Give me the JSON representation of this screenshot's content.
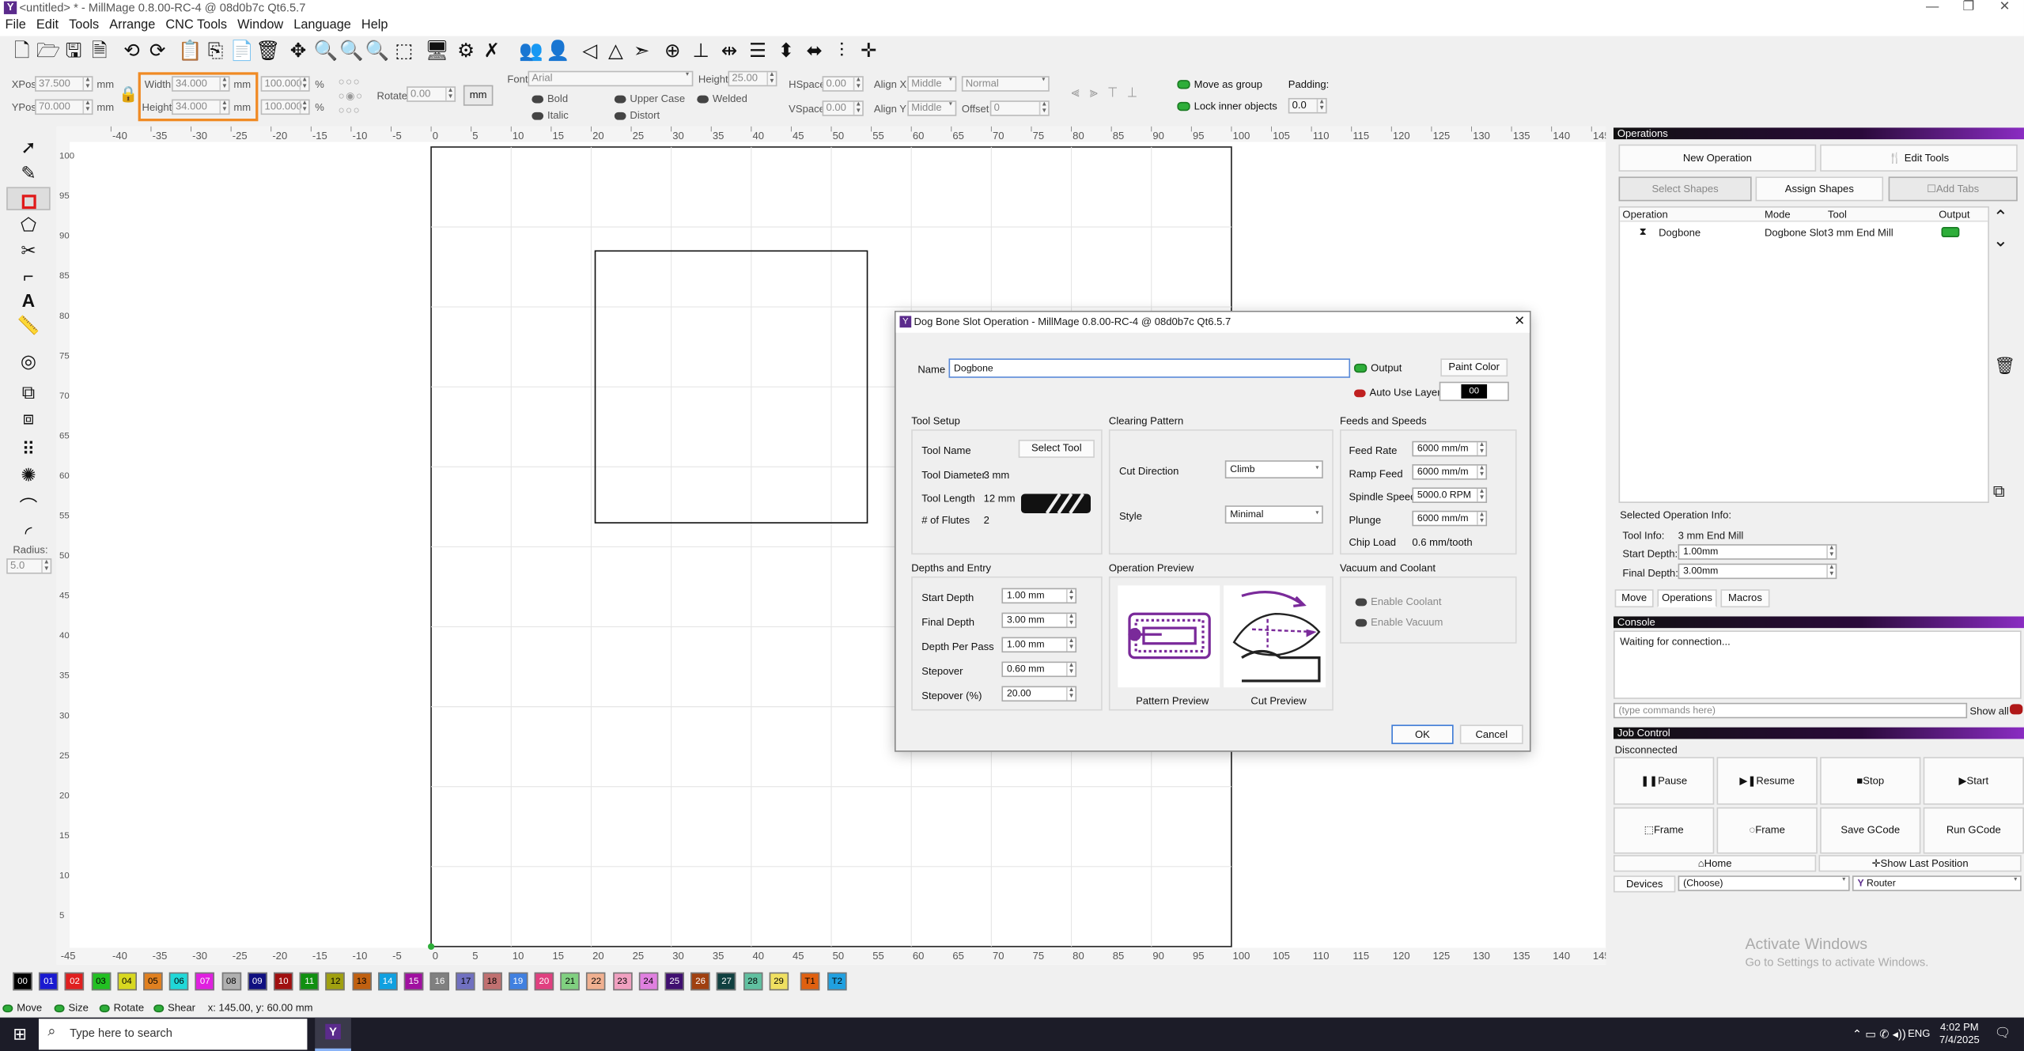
{
  "titlebar": {
    "title": "<untitled> * - MillMage 0.8.00-RC-4 @ 08d0b7c Qt6.5.7",
    "minimize": "—",
    "restore": "❐",
    "close": "✕"
  },
  "menu": [
    "File",
    "Edit",
    "Tools",
    "Arrange",
    "CNC Tools",
    "Window",
    "Language",
    "Help"
  ],
  "props": {
    "xpos_label": "XPos",
    "xpos": "37.500",
    "ypos_label": "YPos",
    "ypos": "70.000",
    "mm": "mm",
    "width_label": "Width",
    "width": "34.000",
    "height_label": "Height",
    "height": "34.000",
    "wpct": "100.000",
    "hpct": "100.000",
    "pct": "%",
    "rotate_label": "Rotate",
    "rotate": "0.00",
    "unit_button": "mm",
    "font_label": "Font",
    "font": "Arial",
    "fheight_label": "Height",
    "fheight": "25.00",
    "bold": "Bold",
    "italic": "Italic",
    "upper": "Upper Case",
    "distort": "Distort",
    "welded": "Welded",
    "hspace_label": "HSpace",
    "hspace": "0.00",
    "vspace_label": "VSpace",
    "vspace": "0.00",
    "alignx_label": "Align X",
    "alignx": "Middle",
    "aligny_label": "Align Y",
    "aligny": "Middle",
    "normal": "Normal",
    "offset_label": "Offset",
    "offset": "0",
    "move_group": "Move as group",
    "lock_inner": "Lock inner objects",
    "padding_label": "Padding:",
    "padding": "0.0"
  },
  "left_tools": {
    "radius_label": "Radius:",
    "radius": "5.0"
  },
  "ruler": {
    "top": [
      "-40",
      "-35",
      "-30",
      "-25",
      "-20",
      "-15",
      "-10",
      "-5",
      "0",
      "5",
      "10",
      "15",
      "20",
      "25",
      "30",
      "35",
      "40",
      "45",
      "50",
      "55",
      "60",
      "65",
      "70",
      "75",
      "80",
      "85",
      "90",
      "95",
      "100",
      "105",
      "110",
      "115",
      "120",
      "125",
      "130",
      "135",
      "140",
      "145"
    ],
    "left": [
      "100",
      "95",
      "90",
      "85",
      "80",
      "75",
      "70",
      "65",
      "60",
      "55",
      "50",
      "45",
      "40",
      "35",
      "30",
      "25",
      "20",
      "15",
      "10",
      "5"
    ],
    "bottom_left": "-45"
  },
  "operations": {
    "header": "Operations",
    "new_op": "New Operation",
    "edit_tools": "Edit Tools",
    "select_shapes": "Select Shapes",
    "assign_shapes": "Assign Shapes",
    "add_tabs": "Add Tabs",
    "columns": [
      "Operation",
      "Mode",
      "Tool",
      "Output"
    ],
    "row": {
      "name": "Dogbone",
      "mode": "Dogbone Slot",
      "tool": "3 mm End Mill"
    },
    "sel_info": "Selected Operation Info:",
    "tool_info_label": "Tool Info:",
    "tool_info": "3 mm End Mill",
    "start_label": "Start Depth:",
    "start": "1.00mm",
    "final_label": "Final Depth:",
    "final": "3.00mm",
    "tabs": [
      "Move",
      "Operations",
      "Macros"
    ]
  },
  "console": {
    "header": "Console",
    "text": "Waiting for connection...",
    "placeholder": "(type commands here)",
    "show_all": "Show all"
  },
  "job": {
    "header": "Job Control",
    "status": "Disconnected",
    "pause": "Pause",
    "resume": "Resume",
    "stop": "Stop",
    "start": "Start",
    "frame1": "Frame",
    "frame2": "Frame",
    "save": "Save GCode",
    "run": "Run GCode",
    "home": "Home",
    "show_last": "Show Last Position",
    "devices": "Devices",
    "choose": "(Choose)",
    "router": "Router"
  },
  "activate": {
    "line1": "Activate Windows",
    "line2": "Go to Settings to activate Windows."
  },
  "dialog": {
    "title": "Dog Bone Slot Operation - MillMage 0.8.00-RC-4 @ 08d0b7c Qt6.5.7",
    "name_label": "Name",
    "name": "Dogbone",
    "output": "Output",
    "paint_color": "Paint Color",
    "auto_layer": "Auto Use Layer",
    "layer": "00",
    "tool_setup": "Tool Setup",
    "tool_name": "Tool Name",
    "select_tool": "Select Tool",
    "tool_diam_label": "Tool Diameter",
    "tool_diam": "3 mm",
    "tool_len_label": "Tool Length",
    "tool_len": "12 mm",
    "flutes_label": "# of Flutes",
    "flutes": "2",
    "clearing": "Clearing Pattern",
    "cut_dir_label": "Cut Direction",
    "cut_dir": "Climb",
    "style_label": "Style",
    "style": "Minimal",
    "feeds": "Feeds and Speeds",
    "feed_label": "Feed Rate",
    "feed": "6000 mm/m",
    "ramp_label": "Ramp Feed",
    "ramp": "6000 mm/m",
    "spindle_label": "Spindle Speed",
    "spindle": "5000.0 RPM",
    "plunge_label": "Plunge",
    "plunge": "6000 mm/m",
    "chip_label": "Chip Load",
    "chip": "0.6 mm/tooth",
    "depths": "Depths and Entry",
    "sd_label": "Start Depth",
    "sd": "1.00 mm",
    "fd_label": "Final Depth",
    "fd": "3.00 mm",
    "dpp_label": "Depth Per Pass",
    "dpp": "1.00 mm",
    "so_label": "Stepover",
    "so": "0.60 mm",
    "sop_label": "Stepover (%)",
    "sop": "20.00",
    "preview": "Operation Preview",
    "pattern_prev": "Pattern Preview",
    "cut_prev": "Cut Preview",
    "vac": "Vacuum and Coolant",
    "coolant": "Enable Coolant",
    "vacuum": "Enable Vacuum",
    "ok": "OK",
    "cancel": "Cancel"
  },
  "palette": [
    {
      "l": "00",
      "c": "#000000",
      "t": "#ffffff"
    },
    {
      "l": "01",
      "c": "#1a1ad0",
      "t": "#ffffff"
    },
    {
      "l": "02",
      "c": "#e02020",
      "t": "#ffffff"
    },
    {
      "l": "03",
      "c": "#22c022",
      "t": "#000000"
    },
    {
      "l": "04",
      "c": "#d8d820",
      "t": "#000000"
    },
    {
      "l": "05",
      "c": "#e08020",
      "t": "#000000"
    },
    {
      "l": "06",
      "c": "#20d8d8",
      "t": "#000000"
    },
    {
      "l": "07",
      "c": "#e020e0",
      "t": "#ffffff"
    },
    {
      "l": "08",
      "c": "#b0b0b0",
      "t": "#000000"
    },
    {
      "l": "09",
      "c": "#101080",
      "t": "#ffffff"
    },
    {
      "l": "10",
      "c": "#a01010",
      "t": "#ffffff"
    },
    {
      "l": "11",
      "c": "#109010",
      "t": "#ffffff"
    },
    {
      "l": "12",
      "c": "#a0a010",
      "t": "#000000"
    },
    {
      "l": "13",
      "c": "#c06010",
      "t": "#000000"
    },
    {
      "l": "14",
      "c": "#10a0e0",
      "t": "#ffffff"
    },
    {
      "l": "15",
      "c": "#a010a0",
      "t": "#ffffff"
    },
    {
      "l": "16",
      "c": "#808080",
      "t": "#ffffff"
    },
    {
      "l": "17",
      "c": "#7070c0",
      "t": "#000000"
    },
    {
      "l": "18",
      "c": "#c07070",
      "t": "#000000"
    },
    {
      "l": "19",
      "c": "#4080e0",
      "t": "#ffffff"
    },
    {
      "l": "20",
      "c": "#e04080",
      "t": "#ffffff"
    },
    {
      "l": "21",
      "c": "#80d080",
      "t": "#000000"
    },
    {
      "l": "22",
      "c": "#f0b090",
      "t": "#000000"
    },
    {
      "l": "23",
      "c": "#f0a0c0",
      "t": "#000000"
    },
    {
      "l": "24",
      "c": "#e080e0",
      "t": "#000000"
    },
    {
      "l": "25",
      "c": "#401070",
      "t": "#ffffff"
    },
    {
      "l": "26",
      "c": "#a04010",
      "t": "#ffffff"
    },
    {
      "l": "27",
      "c": "#104040",
      "t": "#ffffff"
    },
    {
      "l": "28",
      "c": "#60c0a0",
      "t": "#000000"
    },
    {
      "l": "29",
      "c": "#f0e060",
      "t": "#000000"
    },
    {
      "l": "T1",
      "c": "#e06010",
      "t": "#000000"
    },
    {
      "l": "T2",
      "c": "#20a0e0",
      "t": "#000000"
    }
  ],
  "status": {
    "move": "Move",
    "size": "Size",
    "rotate": "Rotate",
    "shear": "Shear",
    "coords": "x: 145.00, y: 60.00 mm"
  },
  "taskbar": {
    "search": "Type here to search",
    "time": "4:02 PM",
    "date": "7/4/2025",
    "lang": "ENG"
  }
}
